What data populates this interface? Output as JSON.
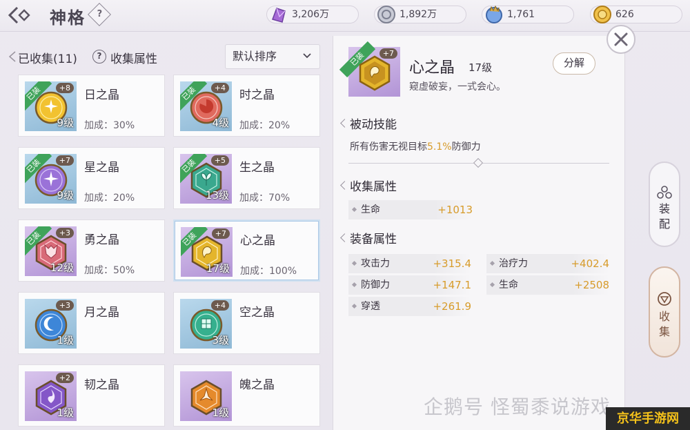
{
  "header": {
    "title": "神格",
    "help_label": "?",
    "resources": [
      {
        "icon": "purple-crystal-icon",
        "value": "3,206万"
      },
      {
        "icon": "silver-coin-icon",
        "value": "1,892万"
      },
      {
        "icon": "blue-orb-icon",
        "value": "1,761"
      },
      {
        "icon": "gold-coin-icon",
        "value": "626"
      }
    ]
  },
  "list": {
    "collected_label": "已收集(11)",
    "help_label": "?",
    "attr_label": "收集属性",
    "sort_label": "默认排序",
    "equipped_tag": "已装",
    "cards": [
      {
        "name": "日之晶",
        "plus": "+8",
        "level": "9级",
        "bonus": "加成：30%",
        "equipped": true,
        "gem": "sun",
        "bg": "blue"
      },
      {
        "name": "时之晶",
        "plus": "+4",
        "level": "4级",
        "bonus": "加成：20%",
        "equipped": true,
        "gem": "time",
        "bg": "blue"
      },
      {
        "name": "星之晶",
        "plus": "+7",
        "level": "9级",
        "bonus": "加成：20%",
        "equipped": true,
        "gem": "star",
        "bg": "blue"
      },
      {
        "name": "生之晶",
        "plus": "+5",
        "level": "13级",
        "bonus": "加成：70%",
        "equipped": true,
        "gem": "life",
        "bg": "purple"
      },
      {
        "name": "勇之晶",
        "plus": "+3",
        "level": "12级",
        "bonus": "加成：50%",
        "equipped": true,
        "gem": "brave",
        "bg": "purple"
      },
      {
        "name": "心之晶",
        "plus": "+7",
        "level": "17级",
        "bonus": "加成：100%",
        "equipped": true,
        "gem": "heart",
        "bg": "purple"
      },
      {
        "name": "月之晶",
        "plus": "+3",
        "level": "1级",
        "bonus": "",
        "equipped": false,
        "gem": "moon",
        "bg": "blue"
      },
      {
        "name": "空之晶",
        "plus": "+4",
        "level": "3级",
        "bonus": "",
        "equipped": false,
        "gem": "sky",
        "bg": "blue"
      },
      {
        "name": "韧之晶",
        "plus": "+2",
        "level": "1级",
        "bonus": "",
        "equipped": false,
        "gem": "tough",
        "bg": "purple"
      },
      {
        "name": "魄之晶",
        "plus": "",
        "level": "1级",
        "bonus": "",
        "equipped": false,
        "gem": "soul",
        "bg": "purple"
      }
    ]
  },
  "detail": {
    "equipped_tag": "已装",
    "plus": "+7",
    "name": "心之晶",
    "level": "17级",
    "quote": "窥虚破妄，一式会心。",
    "decompose_label": "分解",
    "passive_title": "被动技能",
    "passive_prefix": "所有伤害无视目标",
    "passive_highlight": "5.1%",
    "passive_suffix": "防御力",
    "collect_title": "收集属性",
    "collect_attrs": [
      {
        "label": "生命",
        "value": "+1013"
      }
    ],
    "equip_title": "装备属性",
    "equip_attrs": [
      {
        "label": "攻击力",
        "value": "+315.4"
      },
      {
        "label": "治疗力",
        "value": "+402.4"
      },
      {
        "label": "防御力",
        "value": "+147.1"
      },
      {
        "label": "生命",
        "value": "+2508"
      },
      {
        "label": "穿透",
        "value": "+261.9"
      }
    ]
  },
  "side_tabs": {
    "equip_label_1": "装",
    "equip_label_2": "配",
    "collect_label_1": "收",
    "collect_label_2": "集"
  },
  "watermark": {
    "text": "企鹅号 怪蜀黍说游戏",
    "logo": "京华手游网"
  },
  "colors": {
    "accent_gold": "#d79b2a",
    "equipped_green": "#3fa35a",
    "title_text": "#2f2a35"
  }
}
